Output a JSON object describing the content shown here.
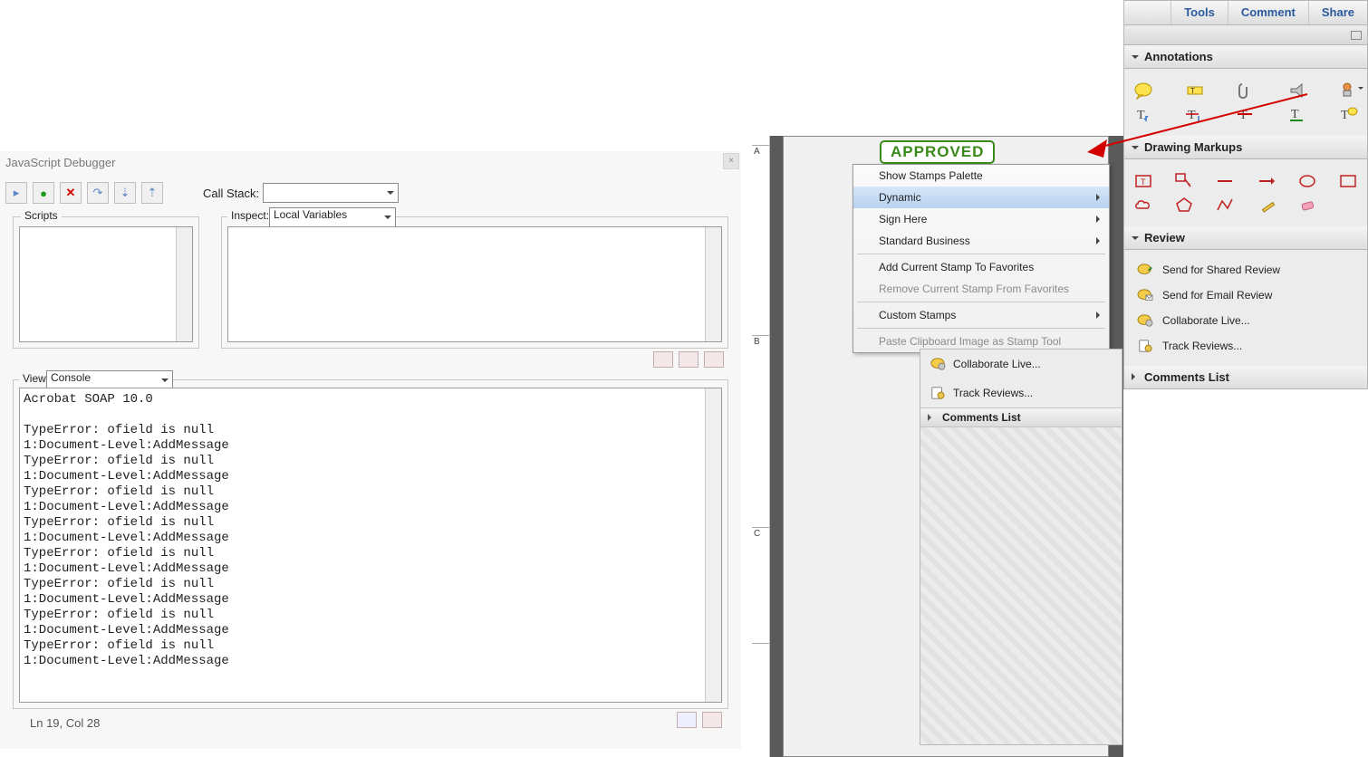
{
  "debugger": {
    "title": "JavaScript Debugger",
    "toolbar": {
      "callstack_label": "Call Stack:"
    },
    "scripts_legend": "Scripts",
    "inspect_legend": "Inspect:",
    "inspect_value": "Local Variables",
    "view_legend": "View:",
    "view_value": "Console",
    "console_text": "Acrobat SOAP 10.0\n\nTypeError: ofield is null\n1:Document-Level:AddMessage\nTypeError: ofield is null\n1:Document-Level:AddMessage\nTypeError: ofield is null\n1:Document-Level:AddMessage\nTypeError: ofield is null\n1:Document-Level:AddMessage\nTypeError: ofield is null\n1:Document-Level:AddMessage\nTypeError: ofield is null\n1:Document-Level:AddMessage\nTypeError: ofield is null\n1:Document-Level:AddMessage\nTypeError: ofield is null\n1:Document-Level:AddMessage",
    "status": "Ln 19, Col 28"
  },
  "ruler": {
    "marks": [
      "A",
      "B",
      "C"
    ]
  },
  "stamp_text": "APPROVED",
  "ctx_menu": {
    "items": [
      {
        "label": "Show Stamps Palette",
        "has_sub": false
      },
      {
        "label": "Dynamic",
        "has_sub": true,
        "hl": true
      },
      {
        "label": "Sign Here",
        "has_sub": true
      },
      {
        "label": "Standard Business",
        "has_sub": true
      }
    ],
    "fav_add": "Add Current Stamp To Favorites",
    "fav_remove": "Remove Current Stamp From Favorites",
    "custom": "Custom Stamps",
    "paste": "Paste Clipboard Image as Stamp Tool"
  },
  "doc_panel": {
    "items": [
      "Collaborate Live...",
      "Track Reviews..."
    ],
    "comments_hdr": "Comments List"
  },
  "right_panel": {
    "tabs": [
      "Tools",
      "Comment",
      "Share"
    ],
    "sections": {
      "annotations": "Annotations",
      "drawing": "Drawing Markups",
      "review": "Review",
      "comments": "Comments List"
    },
    "review_items": [
      "Send for Shared Review",
      "Send for Email Review",
      "Collaborate Live...",
      "Track Reviews..."
    ]
  }
}
